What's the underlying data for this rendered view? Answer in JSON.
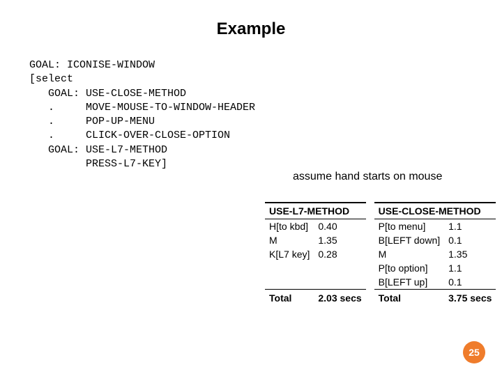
{
  "title": "Example",
  "code": "GOAL: ICONISE-WINDOW\n[select\n   GOAL: USE-CLOSE-METHOD\n   .     MOVE-MOUSE-TO-WINDOW-HEADER\n   .     POP-UP-MENU\n   .     CLICK-OVER-CLOSE-OPTION\n   GOAL: USE-L7-METHOD\n         PRESS-L7-KEY]",
  "assume": "assume hand starts on mouse",
  "table_left": {
    "header": "USE-L7-METHOD",
    "rows": [
      {
        "label": "H[to kbd]",
        "value": "0.40"
      },
      {
        "label": "M",
        "value": "1.35"
      },
      {
        "label": "K[L7 key]",
        "value": "0.28"
      }
    ],
    "total_label": "Total",
    "total_value": "2.03 secs"
  },
  "table_right": {
    "header": "USE-CLOSE-METHOD",
    "rows": [
      {
        "label": "P[to menu]",
        "value": "1.1"
      },
      {
        "label": "B[LEFT down]",
        "value": "0.1"
      },
      {
        "label": "M",
        "value": "1.35"
      },
      {
        "label": "P[to option]",
        "value": "1.1"
      },
      {
        "label": "B[LEFT up]",
        "value": "0.1"
      }
    ],
    "total_label": "Total",
    "total_value": "3.75 secs"
  },
  "page_number": "25"
}
